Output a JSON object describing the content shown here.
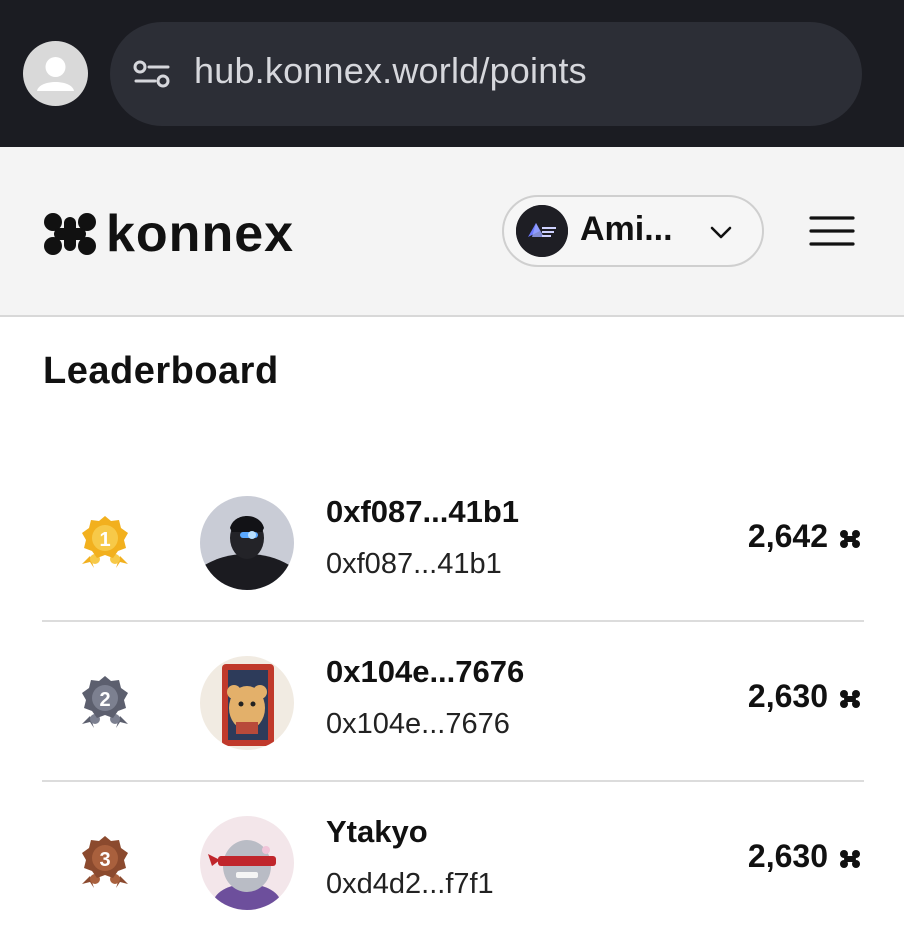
{
  "browser": {
    "url": "hub.konnex.world/points"
  },
  "header": {
    "logo_text": "konnex",
    "account_name": "Ami...",
    "brand_color": "#111111"
  },
  "leaderboard": {
    "title": "Leaderboard",
    "rows": [
      {
        "rank": "1",
        "name": "0xf087...41b1",
        "address": "0xf087...41b1",
        "points": "2,642",
        "badge_color": "#f2b01e"
      },
      {
        "rank": "2",
        "name": "0x104e...7676",
        "address": "0x104e...7676",
        "points": "2,630",
        "badge_color": "#5c5f6e"
      },
      {
        "rank": "3",
        "name": "Ytakyo",
        "address": "0xd4d2...f7f1",
        "points": "2,630",
        "badge_color": "#8b4a2e"
      }
    ]
  }
}
